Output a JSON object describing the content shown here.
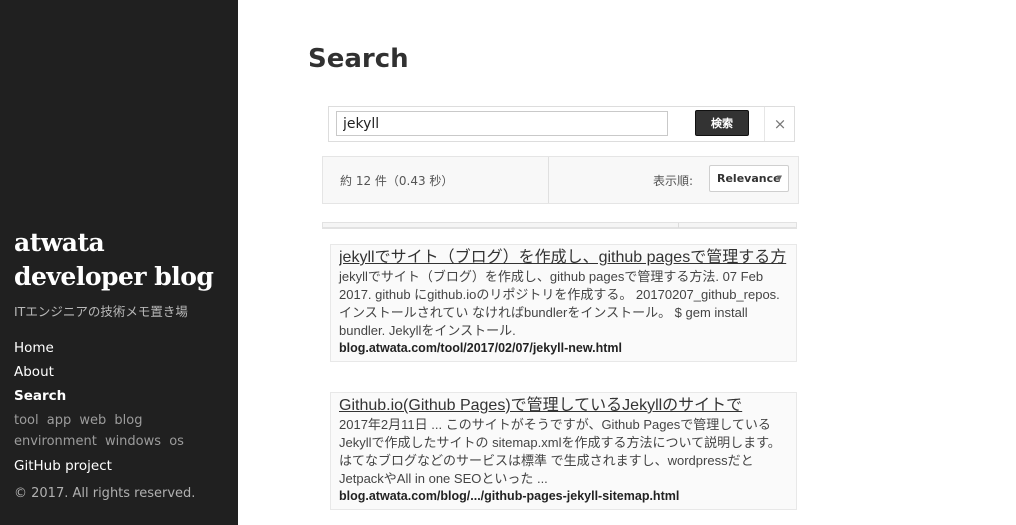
{
  "sidebar": {
    "brand_line1": "atwata",
    "brand_line2": "developer blog",
    "tagline": "ITエンジニアの技術メモ置き場",
    "nav": {
      "home": "Home",
      "about": "About",
      "search": "Search",
      "github": "GitHub project"
    },
    "categories": [
      "tool",
      "app",
      "web",
      "blog",
      "environment",
      "windows",
      "os"
    ],
    "copyright": "© 2017. All rights reserved."
  },
  "main": {
    "title": "Search",
    "search": {
      "value": "jekyll",
      "button_label": "検索",
      "clear_label": "×"
    },
    "info": {
      "count_text": "約 12 件（0.43 秒）",
      "sort_label": "表示順:",
      "sort_value": "Relevance",
      "sort_arrow": "▼"
    },
    "results": [
      {
        "title": "jekyllでサイト（ブログ）を作成し、github pagesで管理する方",
        "snippet": "jekyllでサイト（ブログ）を作成し、github pagesで管理する方法. 07 Feb 2017. github にgithub.ioのリポジトリを作成する。 20170207_github_repos. インストールされてい なければbundlerをインストール。 $ gem install bundler. Jekyllをインストール.",
        "url": "blog.atwata.com/tool/2017/02/07/jekyll-new.html"
      },
      {
        "title": "Github.io(Github Pages)で管理しているJekyllのサイトで",
        "snippet": "2017年2月11日 ... このサイトがそうですが、Github Pagesで管理しているJekyllで作成したサイトの sitemap.xmlを作成する方法について説明します。 はてなブログなどのサービスは標準 で生成されますし、wordpressだとJetpackやAll in one SEOといった ...",
        "url": "blog.atwata.com/blog/.../github-pages-jekyll-sitemap.html"
      }
    ]
  },
  "colors": {
    "sidebar_bg": "#202020",
    "button_bg": "#333333"
  }
}
